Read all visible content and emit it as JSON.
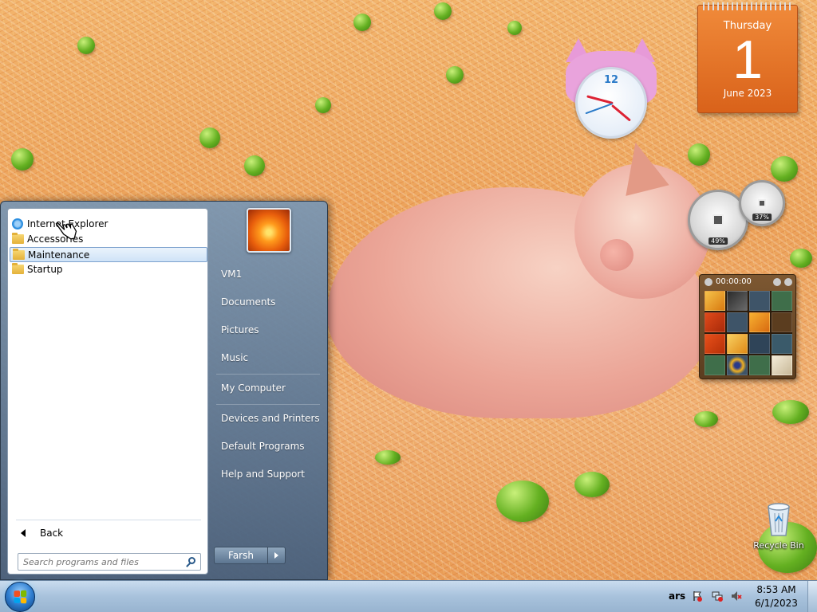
{
  "calendar_gadget": {
    "weekday": "Thursday",
    "day": "1",
    "month_year": "June 2023"
  },
  "clock_gadget": {
    "twelve": "12"
  },
  "gauge_gadget": {
    "cpu_label": "49%",
    "memory_label": "37%"
  },
  "puzzle_gadget": {
    "timer": "00:00:00"
  },
  "desktop": {
    "recycle_bin_label": "Recycle Bin"
  },
  "start_menu": {
    "programs": [
      {
        "label": "Internet Explorer",
        "icon": "internet-explorer-icon"
      },
      {
        "label": "Accessories",
        "icon": "folder-icon"
      },
      {
        "label": "Maintenance",
        "icon": "folder-icon",
        "highlighted": true
      },
      {
        "label": "Startup",
        "icon": "folder-icon"
      }
    ],
    "back_label": "Back",
    "search_placeholder": "Search programs and files",
    "right_items": [
      {
        "label": "VM1"
      },
      {
        "label": "Documents"
      },
      {
        "label": "Pictures"
      },
      {
        "label": "Music"
      },
      {
        "label": "My Computer"
      },
      {
        "label": "Devices and Printers"
      },
      {
        "label": "Default Programs"
      },
      {
        "label": "Help and Support"
      }
    ],
    "shutdown_label": "Farsh"
  },
  "taskbar": {
    "language": "ars",
    "time": "8:53 AM",
    "date": "6/1/2023"
  },
  "colors": {
    "taskbar_top": "#c9dcef",
    "calendar_orange": "#e8721f",
    "highlight_blue": "#cfe3f7"
  }
}
